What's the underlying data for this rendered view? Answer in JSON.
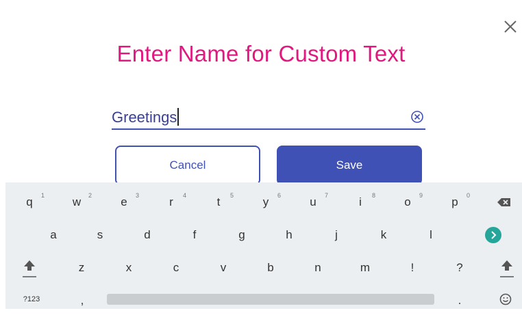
{
  "dialog": {
    "title": "Enter Name for Custom Text",
    "close_icon": "close-icon"
  },
  "field": {
    "value": "Greetings",
    "clear_icon": "clear-circle-icon"
  },
  "buttons": {
    "cancel": "Cancel",
    "save": "Save"
  },
  "keyboard": {
    "row1": [
      {
        "key": "q",
        "hint": "1"
      },
      {
        "key": "w",
        "hint": "2"
      },
      {
        "key": "e",
        "hint": "3"
      },
      {
        "key": "r",
        "hint": "4"
      },
      {
        "key": "t",
        "hint": "5"
      },
      {
        "key": "y",
        "hint": "6"
      },
      {
        "key": "u",
        "hint": "7"
      },
      {
        "key": "i",
        "hint": "8"
      },
      {
        "key": "o",
        "hint": "9"
      },
      {
        "key": "p",
        "hint": "0"
      }
    ],
    "row2": [
      "a",
      "s",
      "d",
      "f",
      "g",
      "h",
      "j",
      "k",
      "l"
    ],
    "row3": [
      "z",
      "x",
      "c",
      "v",
      "b",
      "n",
      "m",
      "!",
      "?"
    ],
    "symbols_key": "?123",
    "comma_key": ",",
    "period_key": "."
  },
  "colors": {
    "title": "#e0187f",
    "accent": "#3f51b5",
    "enter_key": "#26a69a",
    "keyboard_bg": "#eceff1"
  }
}
